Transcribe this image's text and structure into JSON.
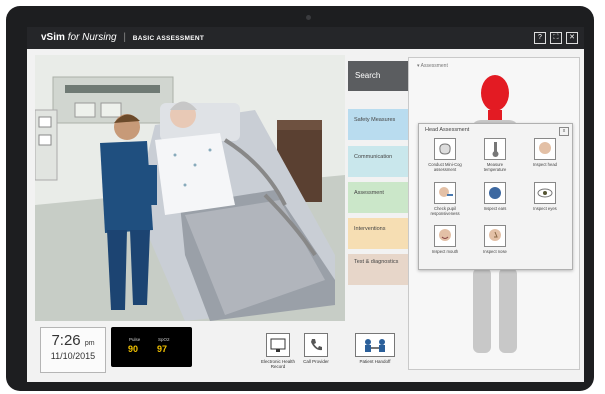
{
  "app": {
    "brand_main": "vSim",
    "brand_sub": "for Nursing",
    "separator": "|",
    "module": "BASIC ASSESSMENT"
  },
  "window_controls": [
    {
      "icon": "help-icon",
      "glyph": "?"
    },
    {
      "icon": "expand-icon",
      "glyph": "⛶"
    },
    {
      "icon": "close-icon",
      "glyph": "✕"
    }
  ],
  "clock": {
    "time": "7:26",
    "ampm": "pm",
    "date": "11/10/2015"
  },
  "vitals": {
    "pulse_label": "Pulse",
    "pulse_value": "90",
    "spo2_label": "SpO2",
    "spo2_value": "97"
  },
  "toolbar": [
    {
      "icon": "monitor-icon",
      "label": "Electronic Health Record"
    },
    {
      "icon": "phone-icon",
      "label": "Call Provider"
    },
    {
      "icon": "handoff-icon",
      "label": "Patient Handoff"
    }
  ],
  "search": {
    "label": "Search"
  },
  "categories": [
    {
      "label": "Safety Measures",
      "color": "#b9dcef"
    },
    {
      "label": "Communication",
      "color": "#c9e7ec"
    },
    {
      "label": "Assessment",
      "color": "#cbe7c9"
    },
    {
      "label": "Interventions",
      "color": "#f6deb3"
    },
    {
      "label": "Test & diagnostics",
      "color": "#e7d6c9"
    }
  ],
  "assessment_panel": {
    "header": "Assessment"
  },
  "head_popup": {
    "title": "Head Assessment",
    "close": "x",
    "items": [
      {
        "label": "Conduct Mini-Cog assessment",
        "icon": "brain-icon"
      },
      {
        "label": "Measure temperature",
        "icon": "thermometer-icon"
      },
      {
        "label": "Inspect head",
        "icon": "head-profile-icon"
      },
      {
        "label": "Check pupil responsiveness",
        "icon": "penlight-icon"
      },
      {
        "label": "Inspect ears",
        "icon": "ear-icon"
      },
      {
        "label": "Inspect eyes",
        "icon": "eye-icon"
      },
      {
        "label": "Inspect mouth",
        "icon": "mouth-icon"
      },
      {
        "label": "Inspect nose",
        "icon": "nose-icon"
      }
    ]
  },
  "colors": {
    "bezel": "#1d1e20",
    "head_highlight": "#e31b23",
    "digits": "#f2c200"
  }
}
